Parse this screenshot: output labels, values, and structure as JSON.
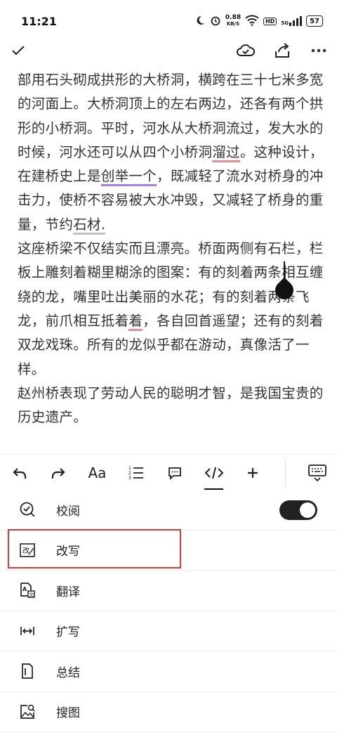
{
  "status": {
    "time": "11:21",
    "net_speed": "0.88",
    "net_unit": "KB/S",
    "hd": "HD",
    "signal": "5G",
    "battery": "57"
  },
  "document": {
    "paragraph1": {
      "before_liuguo": "部用石头砌成拱形的大桥洞，横跨在三十七米多宽的河面上。大桥洞顶上的左右两边，还各有两个拱形的小桥洞。平时，河水从大桥洞流过，发大水的时候，河水还可以从四个小桥洞",
      "liuguo": "溜过",
      "after_liuguo": "。这种设计，在建桥史上是",
      "chuangju": "创举一个",
      "after_chuangju": "，既减轻了流水对桥身的冲击力，使桥不容易被大水冲毁，又减轻了桥身的重量，节约",
      "shicai": "石材.",
      "after_shicai": ""
    },
    "paragraph2": {
      "before_zhe": "这座桥梁不仅结实而且漂亮。桥面两侧有石栏，栏板上雕刻着糊里糊涂的图案：有的刻着两条相互缠绕的龙，嘴里吐出美丽的水花；有的刻着两条飞龙，前爪相互抵着",
      "zhe": "着",
      "after_zhe": "，各自回首遥望；还有的刻着双龙戏珠。所有的龙似乎都在游动，真像活了一样。"
    },
    "paragraph3": "赵州桥表现了劳动人民的聪明才智，是我国宝贵的历史遗产。"
  },
  "format_bar": {
    "font_label": "Aa"
  },
  "menu": {
    "items": [
      {
        "label": "校阅",
        "icon": "proofread-icon"
      },
      {
        "label": "改写",
        "icon": "rewrite-icon"
      },
      {
        "label": "翻译",
        "icon": "translate-icon"
      },
      {
        "label": "扩写",
        "icon": "expand-icon"
      },
      {
        "label": "总结",
        "icon": "summary-icon"
      },
      {
        "label": "搜图",
        "icon": "image-search-icon"
      }
    ],
    "proofread_enabled": true
  },
  "colors": {
    "underline_red": "#f08c97",
    "underline_purple": "#a77cf2",
    "underline_gray": "#c2c2c2",
    "highlight": "#e53935"
  }
}
